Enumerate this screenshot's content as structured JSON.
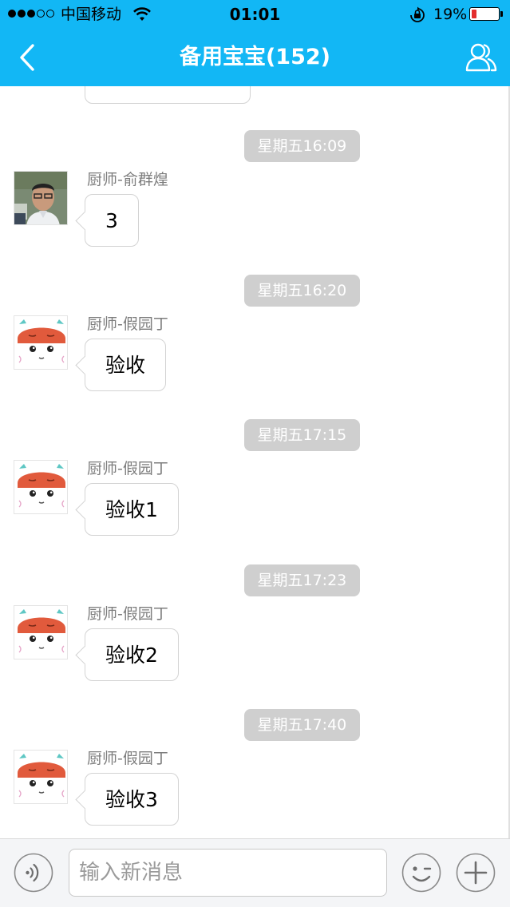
{
  "status_bar": {
    "carrier": "中国移动",
    "time": "01:01",
    "battery_percent": "19%",
    "signal_bars_filled": 3,
    "signal_bars_total": 5,
    "battery_level": 0.19,
    "icons": [
      "wifi-icon",
      "orientation-lock-icon",
      "battery-icon"
    ]
  },
  "nav": {
    "title": "备用宝宝(152)",
    "icons": [
      "back-chevron-icon",
      "group-members-icon"
    ]
  },
  "messages": [
    {
      "timestamp": "星期五16:09",
      "sender": "厨师-俞群煌",
      "text": "3",
      "avatar": "photo-avatar"
    },
    {
      "timestamp": "星期五16:20",
      "sender": "厨师-假园丁",
      "text": "验收",
      "avatar": "cartoon-avatar"
    },
    {
      "timestamp": "星期五17:15",
      "sender": "厨师-假园丁",
      "text": "验收1",
      "avatar": "cartoon-avatar"
    },
    {
      "timestamp": "星期五17:23",
      "sender": "厨师-假园丁",
      "text": "验收2",
      "avatar": "cartoon-avatar"
    },
    {
      "timestamp": "星期五17:40",
      "sender": "厨师-假园丁",
      "text": "验收3",
      "avatar": "cartoon-avatar"
    }
  ],
  "input_bar": {
    "placeholder": "输入新消息",
    "value": "",
    "icons": [
      "voice-icon",
      "emoji-icon",
      "plus-icon"
    ]
  },
  "colors": {
    "header": "#12b7f5",
    "timestamp_bg": "#cfcfcf",
    "battery_low": "#e32d2d",
    "cartoon_hat": "#e15a3c"
  }
}
